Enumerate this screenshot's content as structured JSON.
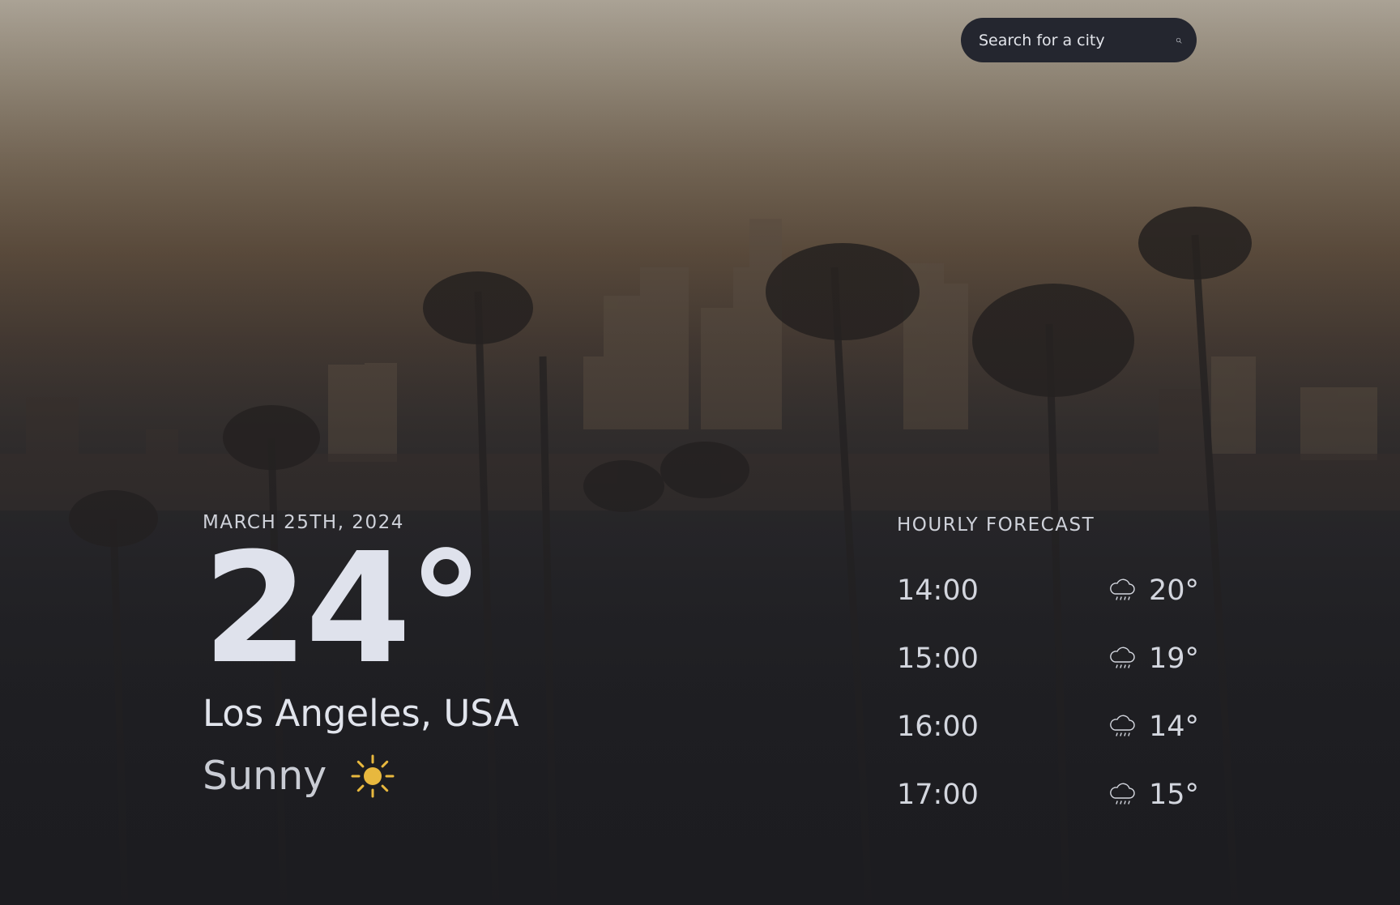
{
  "search": {
    "placeholder": "Search for a city",
    "icon": "search-icon"
  },
  "current": {
    "date": "MARCH 25TH, 2024",
    "temperature": "24°",
    "city": "Los Angeles, USA",
    "condition": "Sunny",
    "condition_icon": "sun-icon"
  },
  "forecast": {
    "title": "HOURLY FORECAST",
    "items": [
      {
        "time": "14:00",
        "temp": "20°",
        "icon": "rain-cloud-icon"
      },
      {
        "time": "15:00",
        "temp": "19°",
        "icon": "rain-cloud-icon"
      },
      {
        "time": "16:00",
        "temp": "14°",
        "icon": "rain-cloud-icon"
      },
      {
        "time": "17:00",
        "temp": "15°",
        "icon": "rain-cloud-icon"
      }
    ]
  },
  "colors": {
    "sun": "#e8b83e",
    "search_bg": "#24262f",
    "text": "#d8dbe4"
  }
}
